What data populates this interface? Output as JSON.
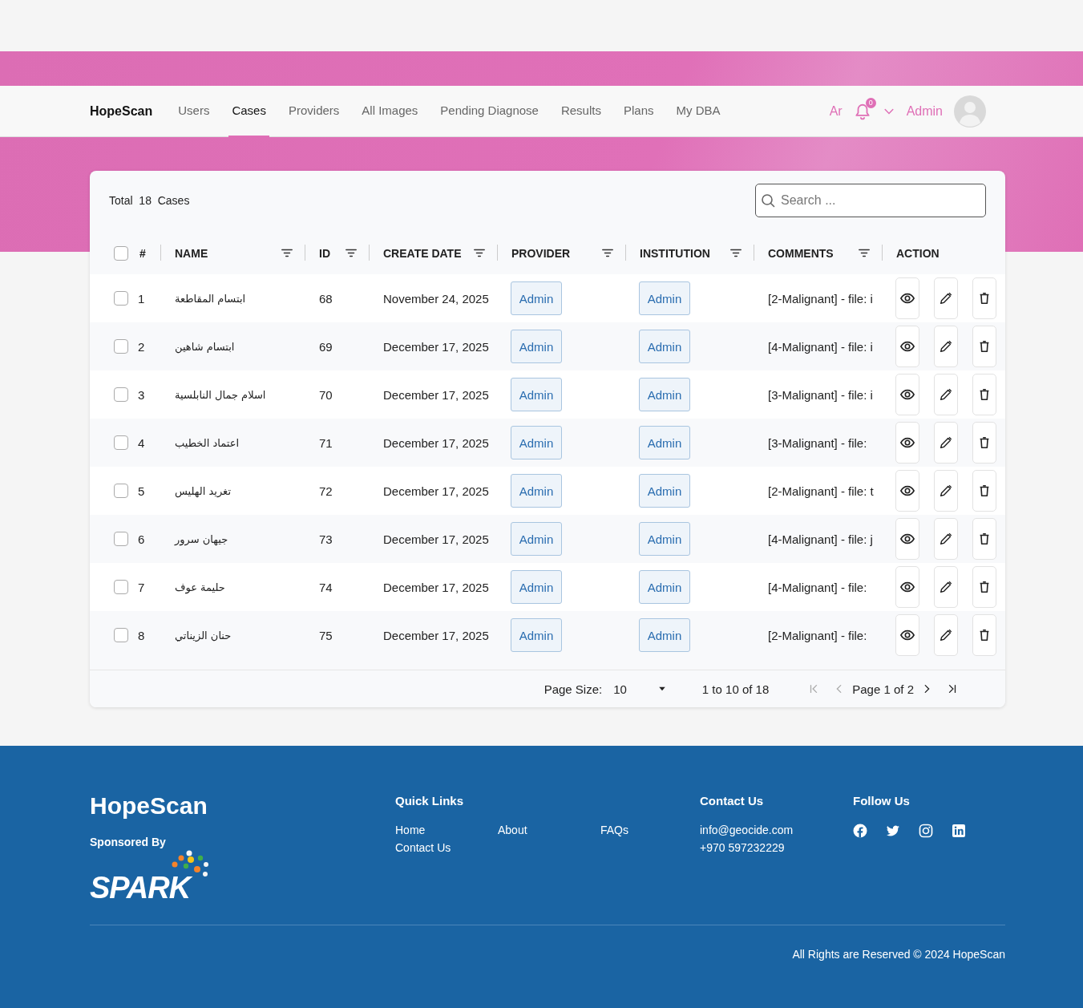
{
  "navbar": {
    "brand": "HopeScan",
    "items": [
      {
        "label": "Users",
        "selected": false
      },
      {
        "label": "Cases",
        "selected": true
      },
      {
        "label": "Providers",
        "selected": false
      },
      {
        "label": "All Images",
        "selected": false
      },
      {
        "label": "Pending Diagnose",
        "selected": false
      },
      {
        "label": "Results",
        "selected": false
      },
      {
        "label": "Plans",
        "selected": false
      },
      {
        "label": "My DBA",
        "selected": false
      }
    ],
    "language": "Ar",
    "notifications": "0",
    "user": "Admin"
  },
  "cases": {
    "total_label": "Total",
    "total": "18",
    "total_unit": "Cases",
    "search": {
      "placeholder": "Search ..."
    },
    "header_checkbox": {
      "checked": false
    },
    "columns": [
      {
        "label": "#",
        "filter": false
      },
      {
        "label": "NAME",
        "filter": true
      },
      {
        "label": "ID",
        "filter": true
      },
      {
        "label": "CREATE DATE",
        "filter": true
      },
      {
        "label": "PROVIDER",
        "filter": true
      },
      {
        "label": "INSTITUTION",
        "filter": true
      },
      {
        "label": "COMMENTS",
        "filter": true
      },
      {
        "label": "ACTION",
        "filter": false
      }
    ],
    "rows": [
      {
        "checked": false,
        "num": "1",
        "name": "ابتسام المقاطعة",
        "id": "68",
        "date": "November 24, 2025",
        "provider": "Admin",
        "institution": "Admin",
        "comment": "[2-Malignant] - file: i"
      },
      {
        "checked": false,
        "num": "2",
        "name": "ابتسام شاهين",
        "id": "69",
        "date": "December 17, 2025",
        "provider": "Admin",
        "institution": "Admin",
        "comment": "[4-Malignant] - file: i"
      },
      {
        "checked": false,
        "num": "3",
        "name": "اسلام جمال النابلسية",
        "id": "70",
        "date": "December 17, 2025",
        "provider": "Admin",
        "institution": "Admin",
        "comment": "[3-Malignant] - file: i"
      },
      {
        "checked": false,
        "num": "4",
        "name": "اعتماد الخطيب",
        "id": "71",
        "date": "December 17, 2025",
        "provider": "Admin",
        "institution": "Admin",
        "comment": "[3-Malignant] - file:"
      },
      {
        "checked": false,
        "num": "5",
        "name": "تغريد الهليس",
        "id": "72",
        "date": "December 17, 2025",
        "provider": "Admin",
        "institution": "Admin",
        "comment": "[2-Malignant] - file: t"
      },
      {
        "checked": false,
        "num": "6",
        "name": "جيهان سرور",
        "id": "73",
        "date": "December 17, 2025",
        "provider": "Admin",
        "institution": "Admin",
        "comment": "[4-Malignant] - file: j"
      },
      {
        "checked": false,
        "num": "7",
        "name": "حليمة عوف",
        "id": "74",
        "date": "December 17, 2025",
        "provider": "Admin",
        "institution": "Admin",
        "comment": "[4-Malignant] - file:"
      },
      {
        "checked": false,
        "num": "8",
        "name": "حنان الزيناتي",
        "id": "75",
        "date": "December 17, 2025",
        "provider": "Admin",
        "institution": "Admin",
        "comment": "[2-Malignant] - file:"
      }
    ],
    "pagination": {
      "page_size_label": "Page Size:",
      "page_size": "10",
      "range": "1 to 10 of 18",
      "page": "Page 1 of 2",
      "first_disabled": true,
      "prev_disabled": true,
      "next_disabled": false,
      "last_disabled": false
    }
  },
  "footer": {
    "brand": "HopeScan",
    "sponsored": "Sponsored By",
    "sponsor_logo": "SPARK",
    "quick_links": {
      "title": "Quick Links",
      "links": [
        "Home",
        "About",
        "FAQs",
        "Contact Us"
      ]
    },
    "contact": {
      "title": "Contact Us",
      "lines": [
        "info@geocide.com",
        "+970 597232229"
      ]
    },
    "follow": {
      "title": "Follow Us",
      "networks": [
        {
          "kind": "facebook"
        },
        {
          "kind": "twitter"
        },
        {
          "kind": "instagram"
        },
        {
          "kind": "linkedin"
        }
      ]
    },
    "copyright": "All Rights are Reserved © 2024 HopeScan"
  }
}
